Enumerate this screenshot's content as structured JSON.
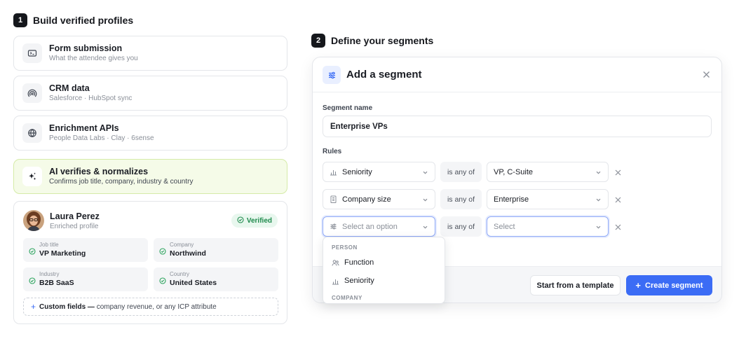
{
  "step1": {
    "number": "1",
    "title": "Build verified profiles"
  },
  "sources": [
    {
      "title": "Form submission",
      "subtitle": "What the attendee gives you",
      "icon": "form-icon"
    },
    {
      "title": "CRM data",
      "subtitle": "Salesforce · HubSpot sync",
      "icon": "sync-signal-icon"
    },
    {
      "title": "Enrichment APIs",
      "subtitle": "People Data Labs · Clay · 6sense",
      "icon": "globe-icon"
    },
    {
      "title": "AI verifies & normalizes",
      "subtitle": "Confirms job title, company, industry & country",
      "icon": "sparkle-icon"
    }
  ],
  "profile": {
    "name": "Laura Perez",
    "subtitle": "Enriched profile",
    "badge": "Verified",
    "fields": [
      {
        "label": "Job title",
        "value": "VP Marketing"
      },
      {
        "label": "Company",
        "value": "Northwind"
      },
      {
        "label": "Industry",
        "value": "B2B SaaS"
      },
      {
        "label": "Country",
        "value": "United States"
      }
    ],
    "custom_bold": "Custom fields —",
    "custom_text": "company revenue, or any ICP attribute"
  },
  "step2": {
    "number": "2",
    "title": "Define your segments"
  },
  "modal": {
    "title": "Add a segment",
    "segment_name_label": "Segment name",
    "segment_name_value": "Enterprise VPs",
    "rules_label": "Rules",
    "rules": [
      {
        "field": "Seniority",
        "operator": "is any of",
        "value": "VP, C-Suite"
      },
      {
        "field": "Company size",
        "operator": "is any of",
        "value": "Enterprise"
      },
      {
        "field": "Select an option",
        "operator": "is any of",
        "value": "Select"
      }
    ],
    "dropdown": {
      "group1": "PERSON",
      "items": [
        "Function",
        "Seniority"
      ],
      "group2": "COMPANY"
    },
    "template_button": "Start from a template",
    "create_button": "Create segment"
  },
  "colors": {
    "accent": "#3b6cf5",
    "verified": "#1e8a4c",
    "ai_card_bg": "#f5fbe8"
  }
}
